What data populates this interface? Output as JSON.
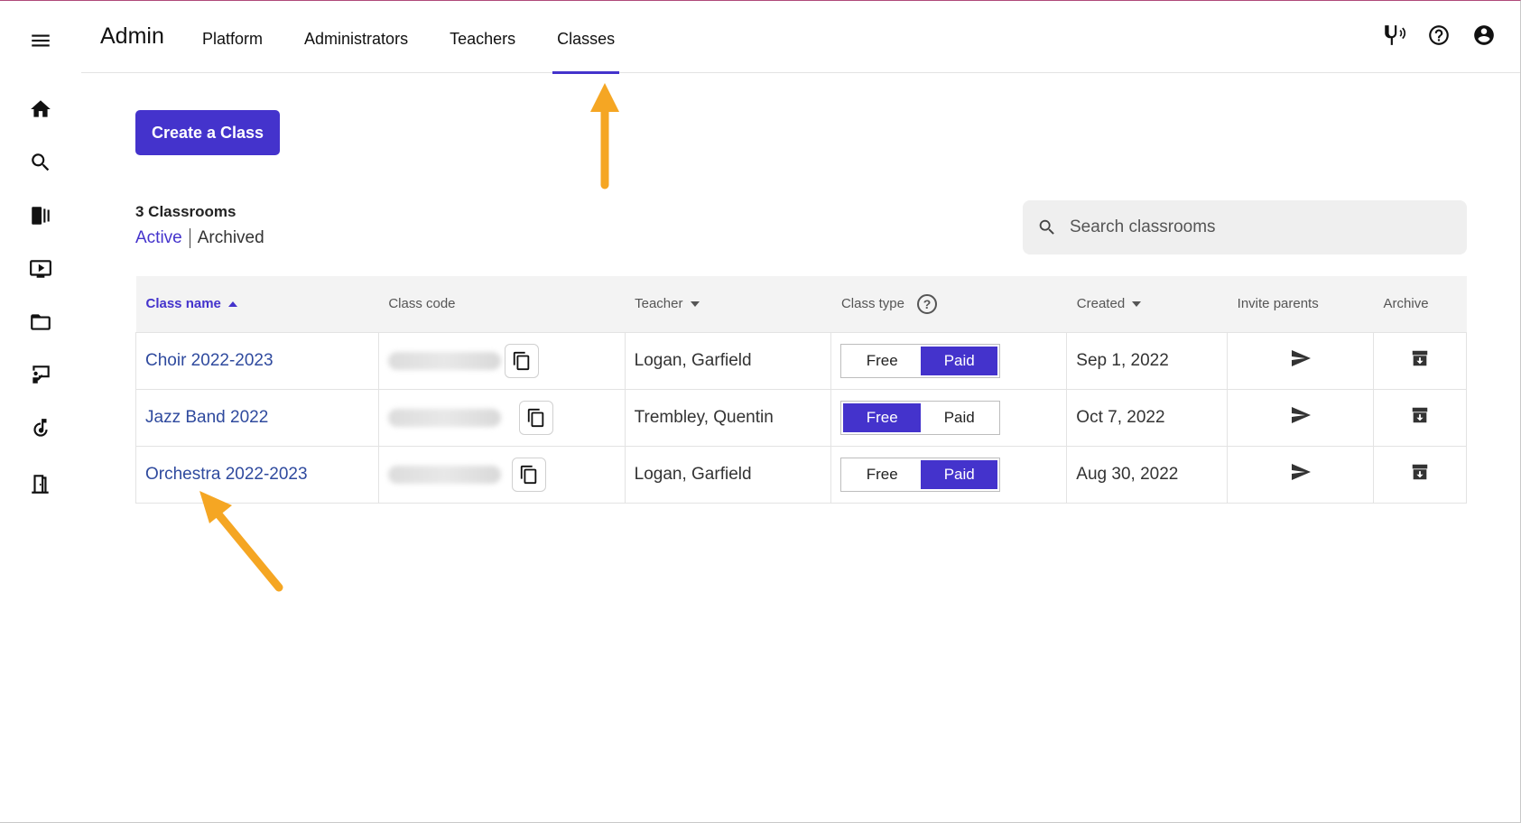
{
  "app": {
    "title": "Admin"
  },
  "nav": {
    "tabs": [
      {
        "label": "Platform"
      },
      {
        "label": "Administrators"
      },
      {
        "label": "Teachers"
      },
      {
        "label": "Classes"
      }
    ],
    "active_tab": "Classes"
  },
  "rail": {
    "icons": [
      "menu-icon",
      "home-icon",
      "search-icon",
      "library-icon",
      "video-icon",
      "folder-icon",
      "teaching-icon",
      "music-note-icon",
      "door-icon"
    ]
  },
  "top_icons": [
    "tuning-fork-icon",
    "help-icon",
    "account-icon"
  ],
  "toolbar": {
    "create_label": "Create a Class"
  },
  "summary": {
    "count_label": "3 Classrooms"
  },
  "filters": {
    "active": "Active",
    "archived": "Archived"
  },
  "search": {
    "placeholder": "Search classrooms"
  },
  "table": {
    "headers": {
      "class_name": "Class name",
      "class_code": "Class code",
      "teacher": "Teacher",
      "class_type": "Class type",
      "created": "Created",
      "invite_parents": "Invite parents",
      "archive": "Archive"
    },
    "rows": [
      {
        "class_name": "Choir 2022-2023",
        "teacher": "Logan, Garfield",
        "type_free": "Free",
        "type_paid": "Paid",
        "selected_type": "Paid",
        "created": "Sep 1, 2022"
      },
      {
        "class_name": "Jazz Band 2022",
        "teacher": "Trembley, Quentin",
        "type_free": "Free",
        "type_paid": "Paid",
        "selected_type": "Free",
        "created": "Oct 7, 2022"
      },
      {
        "class_name": "Orchestra 2022-2023",
        "teacher": "Logan, Garfield",
        "type_free": "Free",
        "type_paid": "Paid",
        "selected_type": "Paid",
        "created": "Aug 30, 2022"
      }
    ]
  },
  "colors": {
    "accent": "#4433cc",
    "link": "#2f4a9e",
    "callout": "#f5a623"
  }
}
